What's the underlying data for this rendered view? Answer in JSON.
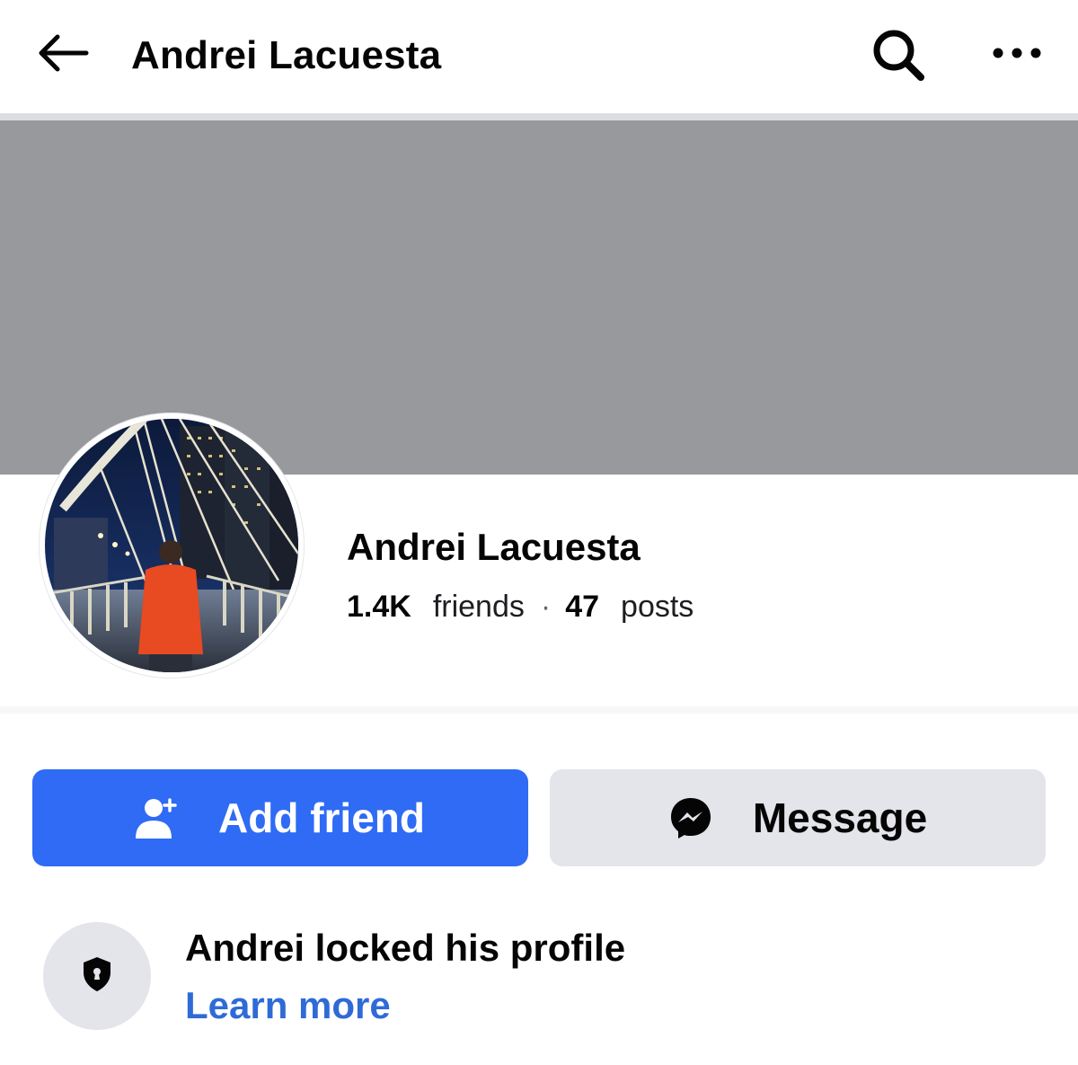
{
  "nav": {
    "title": "Andrei Lacuesta",
    "back_icon": "arrow-left-icon",
    "search_icon": "search-icon",
    "more_icon": "more-horizontal-icon"
  },
  "profile": {
    "name": "Andrei Lacuesta",
    "friends_count": "1.4K",
    "friends_label": "friends",
    "separator": "·",
    "posts_count": "47",
    "posts_label": "posts"
  },
  "actions": {
    "add_friend_label": "Add friend",
    "add_friend_icon": "person-add-icon",
    "message_label": "Message",
    "message_icon": "messenger-icon"
  },
  "lock_notice": {
    "title": "Andrei locked his profile",
    "link": "Learn more",
    "icon": "shield-lock-icon"
  },
  "colors": {
    "primary_blue": "#2f6bf4",
    "link_blue": "#2f6bd6",
    "cover_gray": "#98999d",
    "secondary_button": "#e4e5ea"
  }
}
